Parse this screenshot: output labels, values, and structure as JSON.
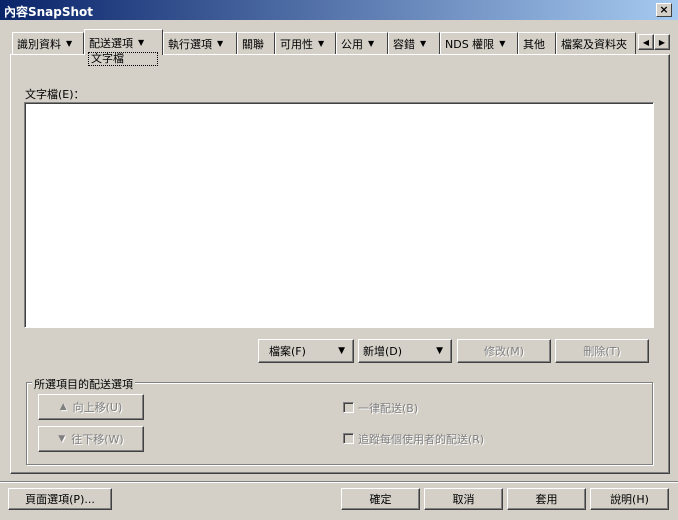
{
  "window": {
    "title": "內容SnapShot",
    "close_label": "×"
  },
  "tabs": [
    {
      "label": "識別資料",
      "has_dropdown": true
    },
    {
      "label": "配送選項",
      "has_dropdown": true,
      "active": true
    },
    {
      "label": "執行選項",
      "has_dropdown": true
    },
    {
      "label": "關聯",
      "has_dropdown": false
    },
    {
      "label": "可用性",
      "has_dropdown": true
    },
    {
      "label": "公用",
      "has_dropdown": true
    },
    {
      "label": "容錯",
      "has_dropdown": true
    },
    {
      "label": "NDS 權限",
      "has_dropdown": true
    },
    {
      "label": "其他",
      "has_dropdown": false
    },
    {
      "label": "檔案及資料夾",
      "has_dropdown": false
    }
  ],
  "active_subpage": "文字檔",
  "text_files": {
    "label": "文字檔(E)：",
    "items": []
  },
  "list_buttons": {
    "file": "檔案(F)",
    "add": "新增(D)",
    "modify": "修改(M)",
    "delete": "刪除(T)"
  },
  "distribution_options": {
    "group_label": "所選項目的配送選項",
    "move_up": "向上移(U)",
    "move_down": "往下移(W)",
    "always_distribute": "一律配送(B)",
    "track_per_user": "追蹤每個使用者的配送(R)"
  },
  "footer": {
    "page_options": "頁面選項(P)...",
    "ok": "確定",
    "cancel": "取消",
    "apply": "套用",
    "help": "說明(H)"
  }
}
